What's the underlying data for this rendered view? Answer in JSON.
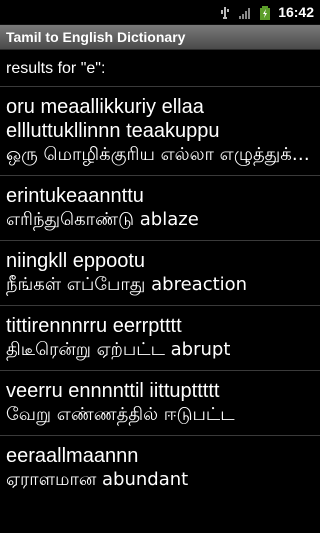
{
  "status_bar": {
    "time": "16:42",
    "icons": [
      "usb-icon",
      "signal-icon",
      "battery-icon"
    ]
  },
  "app": {
    "title": "Tamil to English Dictionary"
  },
  "results": {
    "label": "results for \"e\":",
    "items": [
      {
        "translit": "oru meaallikkuriy ellaa ellluttukllinnn teaakuppu",
        "tamil": "ஒரு மொழிக்குரிய எல்லா எழுத்துக்களின் தொகுப்பு"
      },
      {
        "translit": "erintukeaannttu",
        "tamil": "எரிந்துகொண்டு ablaze"
      },
      {
        "translit": "niingkll eppootu",
        "tamil": "நீங்கள் எப்போது abreaction"
      },
      {
        "translit": "tittirennnrru eerrptttt",
        "tamil": "திடீரென்று ஏற்பட்ட abrupt"
      },
      {
        "translit": "veerru ennnnttil iittupttttt",
        "tamil": "வேறு எண்ணத்தில் ஈடுபட்ட"
      },
      {
        "translit": "eeraallmaannn",
        "tamil": "ஏராளமான abundant"
      }
    ]
  }
}
